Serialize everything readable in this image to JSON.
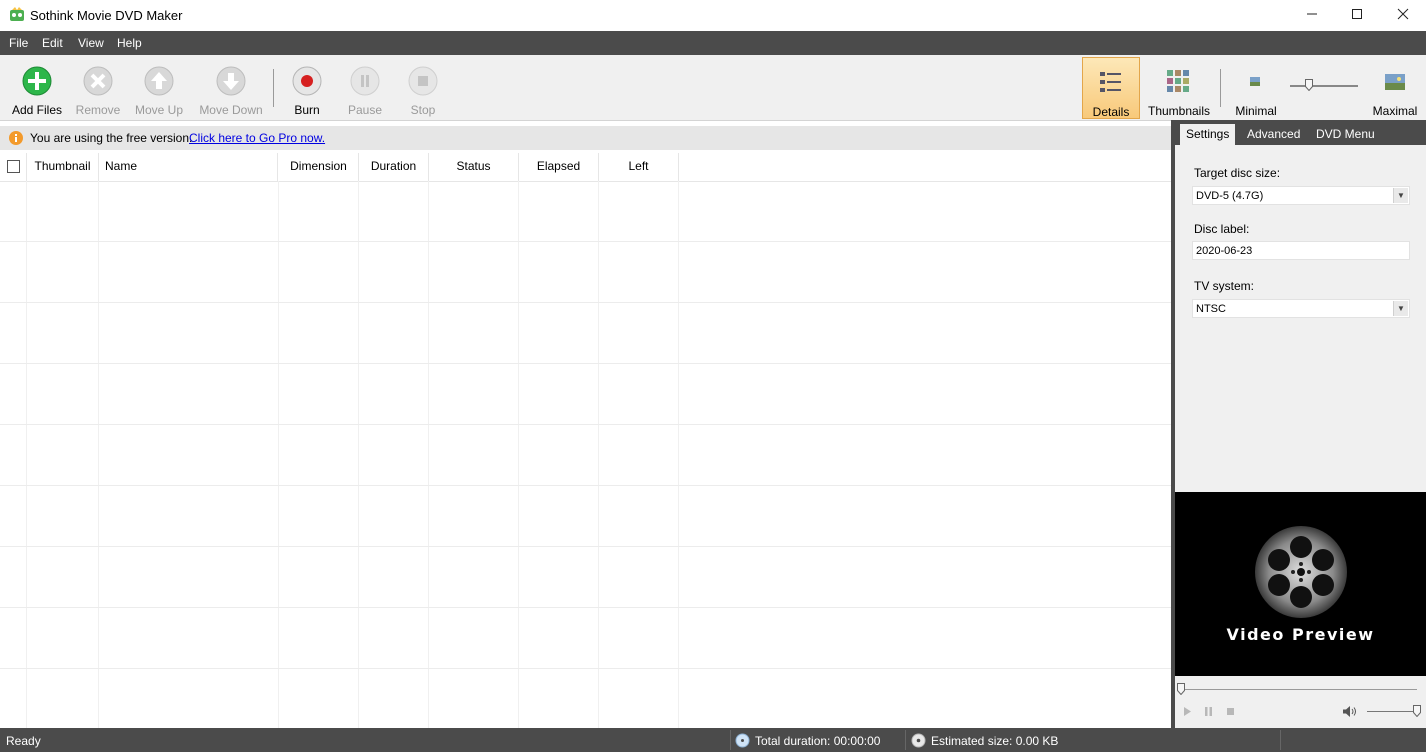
{
  "window": {
    "title": "Sothink Movie DVD Maker"
  },
  "menu": [
    "File",
    "Edit",
    "View",
    "Help"
  ],
  "toolbar": {
    "add_files": "Add Files",
    "remove": "Remove",
    "move_up": "Move Up",
    "move_down": "Move Down",
    "burn": "Burn",
    "pause": "Pause",
    "stop": "Stop",
    "details": "Details",
    "thumbnails": "Thumbnails",
    "minimal": "Minimal",
    "maximal": "Maximal"
  },
  "infobar": {
    "text": "You are using the free version.",
    "link": "Click here to Go Pro now."
  },
  "table": {
    "columns": [
      "Thumbnail",
      "Name",
      "Dimension",
      "Duration",
      "Status",
      "Elapsed",
      "Left"
    ]
  },
  "panel": {
    "tabs": [
      "Settings",
      "Advanced",
      "DVD Menu"
    ],
    "target_disc_label": "Target disc size:",
    "target_disc_value": "DVD-5 (4.7G)",
    "disc_label_label": "Disc label:",
    "disc_label_value": "2020-06-23",
    "tv_system_label": "TV system:",
    "tv_system_value": "NTSC",
    "preview_text": "Video Preview"
  },
  "status": {
    "state": "Ready",
    "total_duration": "Total duration: 00:00:00",
    "estimated_size": "Estimated size: 0.00 KB"
  },
  "colors": {
    "menubar": "#4b4b4b",
    "accent_orange": "#f8c97a",
    "link": "#0000e0",
    "add_green": "#2db64a",
    "burn_red": "#d62020"
  }
}
